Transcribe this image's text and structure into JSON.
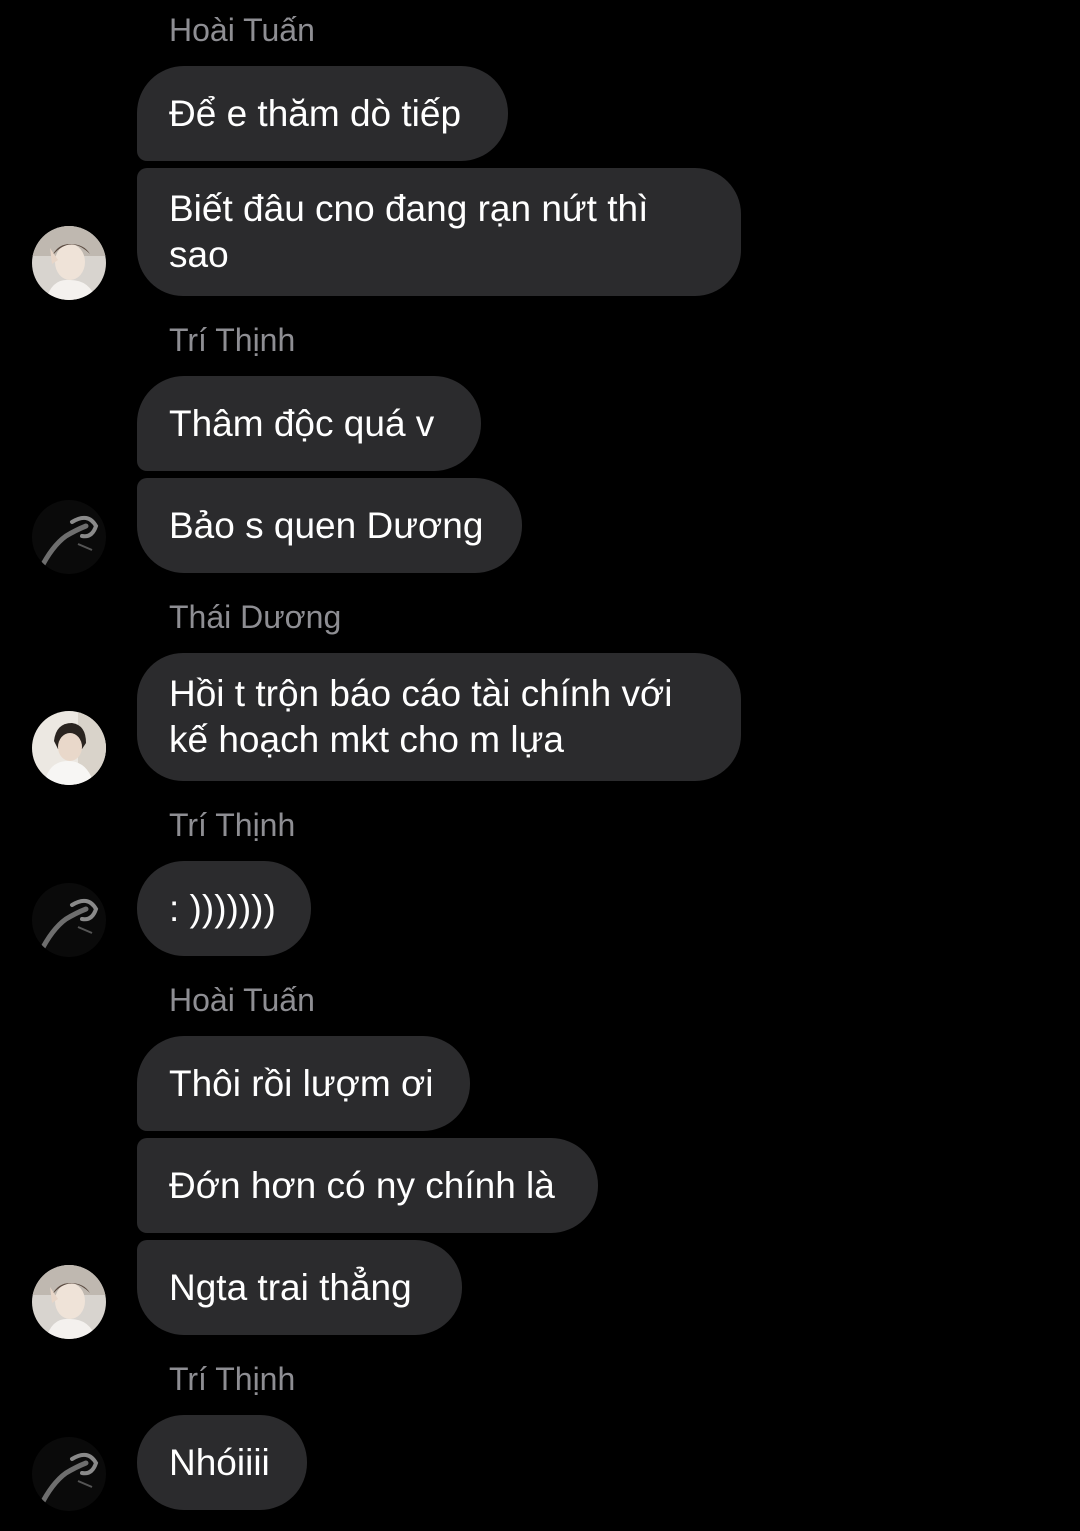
{
  "chat": {
    "senders": {
      "s1": "Hoài Tuấn",
      "s2": "Trí Thịnh",
      "s3": "Thái Dương",
      "s4": "Trí Thịnh",
      "s5": "Hoài Tuấn",
      "s6": "Trí Thịnh"
    },
    "messages": {
      "m1": "Để e thăm dò tiếp",
      "m2": "Biết đâu cno đang rạn nứt thì\nsao",
      "m3": "Thâm độc quá v",
      "m4": "Bảo s quen Dương",
      "m5": "Hồi t trộn báo cáo tài chính với\nkế hoạch mkt cho m lựa",
      "m6": ": )))))))",
      "m7": "Thôi rồi lượm ơi",
      "m8": "Đớn hơn có ny chính là",
      "m9": "Ngta trai thẳng",
      "m10": "Nhóiiii"
    },
    "avatars": {
      "hoai_tuan": "avatar-hoai-tuan",
      "tri_thinh": "avatar-tri-thinh",
      "thai_duong": "avatar-thai-duong"
    }
  },
  "colors": {
    "background": "#000000",
    "bubble": "#2b2b2d",
    "sender_text": "#8e8e93",
    "message_text": "#ffffff"
  }
}
